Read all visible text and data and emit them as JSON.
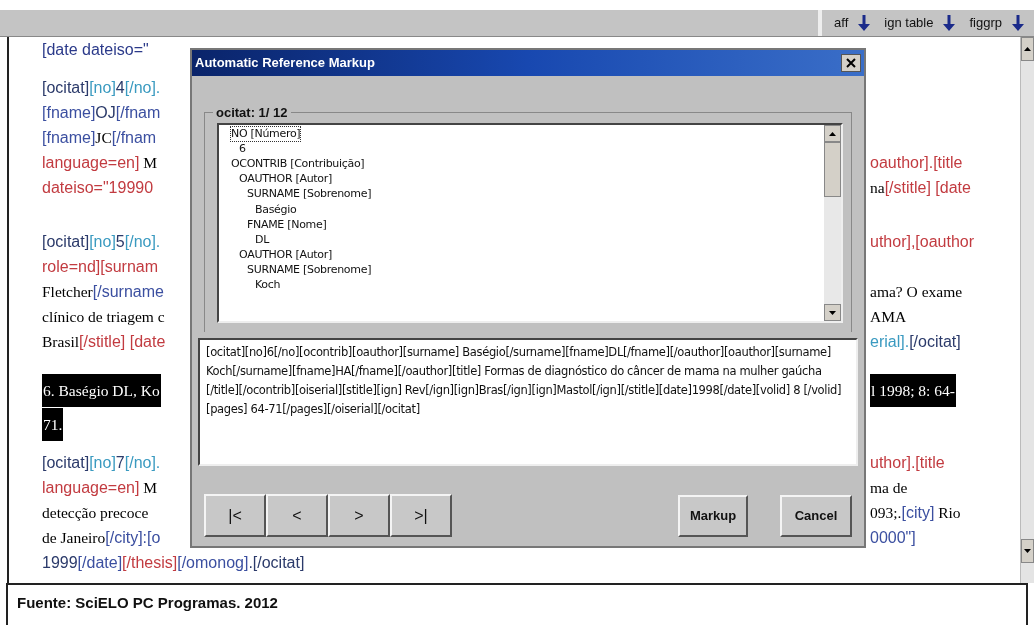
{
  "toolbar": {
    "items": [
      {
        "label": "aff"
      },
      {
        "label": "ign table"
      },
      {
        "label": "figgrp"
      }
    ]
  },
  "document": {
    "paragraphs": [
      {
        "selected": false,
        "lines": [
          {
            "left": [
              {
                "kind": "tag",
                "color": "#2b3a8a",
                "text": "[date dateiso=\""
              }
            ]
          }
        ]
      },
      {
        "selected": false,
        "lines": [
          {
            "left": [
              {
                "kind": "tag",
                "color": "#2b3a6a",
                "text": "[ocitat]"
              },
              {
                "kind": "tag",
                "color": "#3a9ac0",
                "text": "[no]"
              },
              {
                "kind": "tag",
                "color": "#2b3a6a",
                "text": "4"
              },
              {
                "kind": "tag",
                "color": "#3a9ac0",
                "text": "[/no]."
              }
            ]
          },
          {
            "left": [
              {
                "kind": "tag",
                "color": "#3b4fa0",
                "text": "[fname]"
              },
              {
                "kind": "tag",
                "color": "#2b3a6a",
                "text": "OJ"
              },
              {
                "kind": "tag",
                "color": "#3b4fa0",
                "text": "[/fnam"
              }
            ]
          },
          {
            "left": [
              {
                "kind": "tag",
                "color": "#3b4fa0",
                "text": "[fname]"
              },
              {
                "kind": "text",
                "text": "JC"
              },
              {
                "kind": "tag",
                "color": "#3b4fa0",
                "text": "[/fnam"
              }
            ]
          },
          {
            "left": [
              {
                "kind": "tag",
                "color": "#c23b40",
                "text": "language=en]"
              },
              {
                "kind": "text",
                "text": " M"
              }
            ],
            "right": [
              {
                "kind": "tag",
                "color": "#c23b40",
                "text": "oauthor].[title"
              }
            ]
          },
          {
            "left": [
              {
                "kind": "tag",
                "color": "#c23b40",
                "text": "dateiso=\"19990"
              }
            ],
            "right": [
              {
                "kind": "text",
                "text": "na"
              },
              {
                "kind": "tag",
                "color": "#c23b40",
                "text": "[/stitle] [date"
              }
            ]
          }
        ]
      },
      {
        "selected": false,
        "lines": [
          {
            "left": [
              {
                "kind": "tag",
                "color": "#2b3a6a",
                "text": "[ocitat]"
              },
              {
                "kind": "tag",
                "color": "#3a9ac0",
                "text": "[no]"
              },
              {
                "kind": "tag",
                "color": "#2b3a6a",
                "text": "5"
              },
              {
                "kind": "tag",
                "color": "#3a9ac0",
                "text": "[/no]."
              }
            ],
            "right": [
              {
                "kind": "tag",
                "color": "#c23b40",
                "text": "uthor],[oauthor"
              }
            ]
          },
          {
            "left": [
              {
                "kind": "tag",
                "color": "#c23b40",
                "text": "role=nd][surnam"
              }
            ]
          },
          {
            "left": [
              {
                "kind": "text",
                "text": "Fletcher"
              },
              {
                "kind": "tag",
                "color": "#3b4fa0",
                "text": "[/surname"
              }
            ],
            "right": [
              {
                "kind": "text",
                "text": "ama? O exame"
              }
            ]
          },
          {
            "left": [
              {
                "kind": "text",
                "text": "clínico de triagem c"
              }
            ],
            "right": [
              {
                "kind": "text",
                "text": "AMA"
              }
            ]
          },
          {
            "left": [
              {
                "kind": "text",
                "text": "Brasil"
              },
              {
                "kind": "tag",
                "color": "#c23b40",
                "text": "[/stitle] [date"
              }
            ],
            "right": [
              {
                "kind": "tag",
                "color": "#3a9ac0",
                "text": "erial]."
              },
              {
                "kind": "tag",
                "color": "#2b3a6a",
                "text": "[/ocitat]"
              }
            ]
          }
        ]
      },
      {
        "selected": true,
        "lines": [
          {
            "left": [
              {
                "kind": "text",
                "text": "6. Baségio DL, Ko"
              }
            ],
            "right": [
              {
                "kind": "text",
                "text": "l 1998; 8: 64-"
              }
            ]
          },
          {
            "left": [
              {
                "kind": "text",
                "text": "71."
              }
            ]
          }
        ]
      },
      {
        "selected": false,
        "lines": [
          {
            "left": [
              {
                "kind": "tag",
                "color": "#2b3a6a",
                "text": "[ocitat]"
              },
              {
                "kind": "tag",
                "color": "#3a9ac0",
                "text": "[no]"
              },
              {
                "kind": "tag",
                "color": "#2b3a6a",
                "text": "7"
              },
              {
                "kind": "tag",
                "color": "#3a9ac0",
                "text": "[/no]."
              }
            ],
            "right": [
              {
                "kind": "tag",
                "color": "#c23b40",
                "text": "uthor].[title"
              }
            ]
          },
          {
            "left": [
              {
                "kind": "tag",
                "color": "#c23b40",
                "text": "language=en]"
              },
              {
                "kind": "text",
                "text": " M"
              }
            ],
            "right": [
              {
                "kind": "text",
                "text": "ma de"
              }
            ]
          },
          {
            "left": [
              {
                "kind": "text",
                "text": "detecção precoce"
              }
            ],
            "right": [
              {
                "kind": "text",
                "text": "093;."
              },
              {
                "kind": "tag",
                "color": "#3b4fa0",
                "text": "[city]"
              },
              {
                "kind": "text",
                "text": " Rio"
              }
            ]
          },
          {
            "left": [
              {
                "kind": "text",
                "text": "de Janeiro"
              },
              {
                "kind": "tag",
                "color": "#3b4fa0",
                "text": "[/city]:[o"
              }
            ],
            "right": [
              {
                "kind": "tag",
                "color": "#3b4fa0",
                "text": "0000\"]"
              }
            ]
          },
          {
            "left": [
              {
                "kind": "tag",
                "color": "#2b3a6a",
                "text": "1999"
              },
              {
                "kind": "tag",
                "color": "#3b4fa0",
                "text": "[/date]"
              },
              {
                "kind": "tag",
                "color": "#c23b40",
                "text": "[/thesis]"
              },
              {
                "kind": "tag",
                "color": "#3b4fa0",
                "text": "[/omonog]"
              },
              {
                "kind": "tag",
                "color": "#2b3a6a",
                "text": ".[/ocitat]"
              }
            ]
          }
        ]
      }
    ]
  },
  "dialog": {
    "title": "Automatic Reference Markup",
    "group_label": "ocitat: 1/ 12",
    "tree": [
      {
        "label": "NO [Número]",
        "selected": true,
        "children": [
          {
            "label": "6",
            "selected": false
          }
        ]
      },
      {
        "label": "OCONTRIB [Contribuição]",
        "selected": false,
        "children": [
          {
            "label": "OAUTHOR [Autor]",
            "selected": false,
            "children": [
              {
                "label": "SURNAME [Sobrenome]",
                "selected": false,
                "children": [
                  {
                    "label": "Baségio",
                    "selected": false
                  }
                ]
              },
              {
                "label": "FNAME [Nome]",
                "selected": false,
                "children": [
                  {
                    "label": "DL",
                    "selected": false
                  }
                ]
              }
            ]
          },
          {
            "label": "OAUTHOR [Autor]",
            "selected": false,
            "children": [
              {
                "label": "SURNAME [Sobrenome]",
                "selected": false,
                "children": [
                  {
                    "label": "Koch",
                    "selected": false
                  }
                ]
              }
            ]
          }
        ]
      }
    ],
    "markup_text": "[ocitat][no]6[/no][ocontrib][oauthor][surname] Baségio[/surname][fname]DL[/fname][/oauthor][oauthor][surname] Koch[/surname][fname]HA[/fname][/oauthor][title] Formas de diagnóstico do câncer de mama na mulher gaúcha[/title][/ocontrib][oiserial][stitle][ign] Rev[/ign][ign]Bras[/ign][ign]Mastol[/ign][/stitle][date]1998[/date][volid] 8 [/volid][pages] 64-71[/pages][/oiserial][/ocitat]",
    "nav_buttons": [
      "|<",
      "<",
      ">",
      ">|"
    ],
    "markup_button": "Markup",
    "cancel_button": "Cancel"
  },
  "caption": "Fuente: SciELO PC Programas. 2012"
}
